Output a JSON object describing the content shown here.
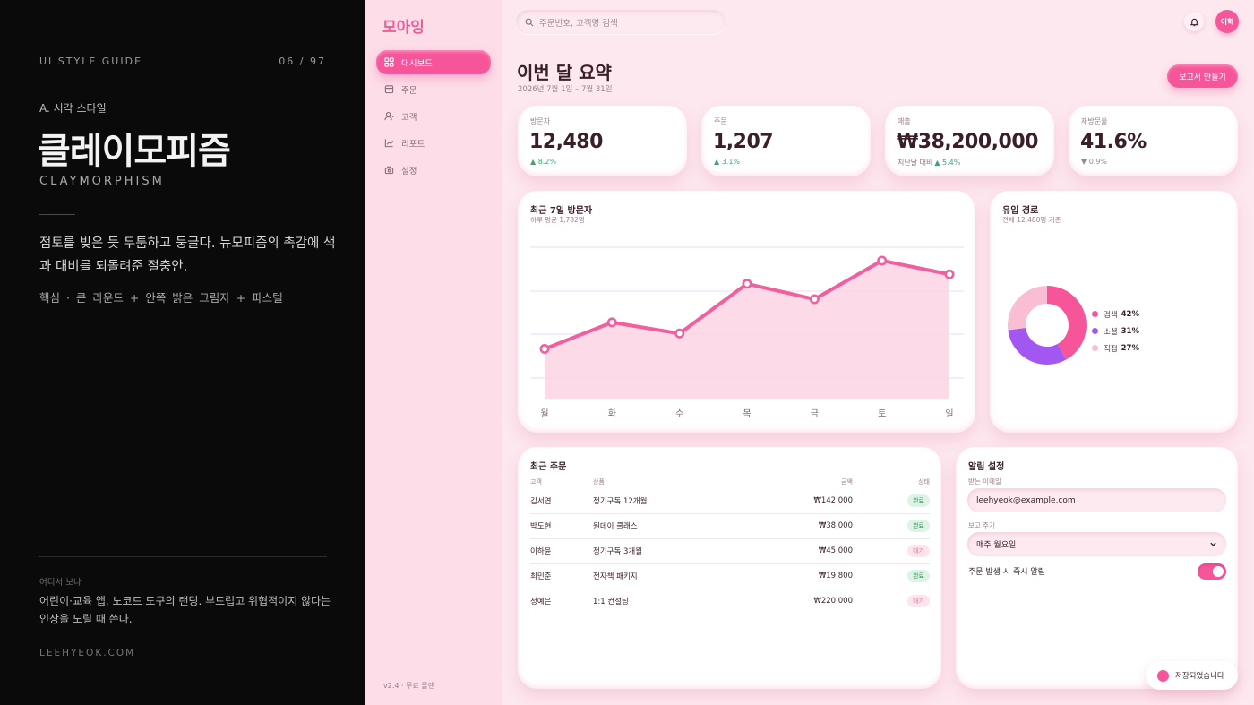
{
  "guide": {
    "label": "UI STYLE GUIDE",
    "page": "06 / 97",
    "section": "A. 시각 스타일",
    "title": "클레이모피즘",
    "subtitle": "CLAYMORPHISM",
    "description": "점토를 빚은 듯 두툼하고 둥글다. 뉴모피즘의 촉감에 색과 대비를 되돌려준 절충안.",
    "core": "핵심 · 큰 라운드 + 안쪽 밝은 그림자 + 파스텔",
    "where_label": "어디서 보나",
    "where": "어린이·교육 앱, 노코드 도구의 랜딩. 부드럽고 위협적이지 않다는 인상을 노릴 때 쓴다.",
    "site": "LEEHYEOK.COM"
  },
  "app": {
    "logo": "모아잉",
    "version": "v2.4 · 무료 플랜",
    "nav": [
      {
        "label": "대시보드",
        "icon": "grid-icon"
      },
      {
        "label": "주문",
        "icon": "box-icon"
      },
      {
        "label": "고객",
        "icon": "user-icon"
      },
      {
        "label": "리포트",
        "icon": "chart-icon"
      },
      {
        "label": "설정",
        "icon": "settings-icon"
      }
    ],
    "search_placeholder": "주문번호, 고객명 검색",
    "avatar": "이혁",
    "page_title": "이번 달 요약",
    "page_sub": "2026년 7월 1일 – 7월 31일",
    "report_button": "보고서 만들기",
    "kpis": [
      {
        "label": "방문자",
        "value": "12,480",
        "prefix": "",
        "delta": "▲ 8.2%",
        "dir": "up"
      },
      {
        "label": "주문",
        "value": "1,207",
        "prefix": "",
        "delta": "▲ 3.1%",
        "dir": "up"
      },
      {
        "label": "매출",
        "value": "₩38,200,000",
        "prefix": "지난달 대비",
        "delta": "▲ 5.4%",
        "dir": "up"
      },
      {
        "label": "재방문율",
        "value": "41.6%",
        "prefix": "",
        "delta": "▼ 0.9%",
        "dir": "down"
      }
    ],
    "visitors_card": {
      "title": "최근 7일 방문자",
      "sub": "하루 평균 1,782명"
    },
    "traffic_card": {
      "title": "유입 경로",
      "sub": "전체 12,480명 기준"
    },
    "orders_card": {
      "title": "최근 주문",
      "columns": [
        "고객",
        "상품",
        "금액",
        "상태"
      ],
      "rows": [
        {
          "customer": "김서연",
          "product": "정기구독 12개월",
          "amount": "₩142,000",
          "status": "완료",
          "kind": "done"
        },
        {
          "customer": "박도현",
          "product": "원데이 클래스",
          "amount": "₩38,000",
          "status": "완료",
          "kind": "done"
        },
        {
          "customer": "이하윤",
          "product": "정기구독 3개월",
          "amount": "₩45,000",
          "status": "대기",
          "kind": "wait"
        },
        {
          "customer": "최민준",
          "product": "전자책 패키지",
          "amount": "₩19,800",
          "status": "완료",
          "kind": "done"
        },
        {
          "customer": "정예은",
          "product": "1:1 컨설팅",
          "amount": "₩220,000",
          "status": "대기",
          "kind": "wait"
        }
      ]
    },
    "alerts_card": {
      "title": "알림 설정",
      "email_label": "받는 이메일",
      "email_value": "leehyeok@example.com",
      "period_label": "보고 주기",
      "period_value": "매주 월요일",
      "toggle_label": "주문 발생 시 즉시 알림",
      "toggle_on": true
    },
    "toast": "저장되었습니다"
  },
  "colors": {
    "accent": "#f7559a",
    "line": "#f0609e",
    "area": "#fbd3e3",
    "up": "#3aa76d"
  },
  "chart_data": [
    {
      "type": "line",
      "categories": [
        "월",
        "화",
        "수",
        "목",
        "금",
        "토",
        "일"
      ],
      "series": [
        {
          "values": [
            1280,
            1590,
            1460,
            2040,
            1860,
            2310,
            2150
          ]
        }
      ],
      "ylim": [
        700,
        2550
      ],
      "grid": true
    },
    {
      "type": "pie",
      "donut": true,
      "labels": [
        "검색",
        "소셜",
        "직접"
      ],
      "values": [
        42,
        31,
        27
      ],
      "value_labels": [
        "42%",
        "31%",
        "27%"
      ],
      "colors": [
        "#f7559a",
        "#a257f0",
        "#f9bed4"
      ],
      "legend": "right"
    }
  ]
}
